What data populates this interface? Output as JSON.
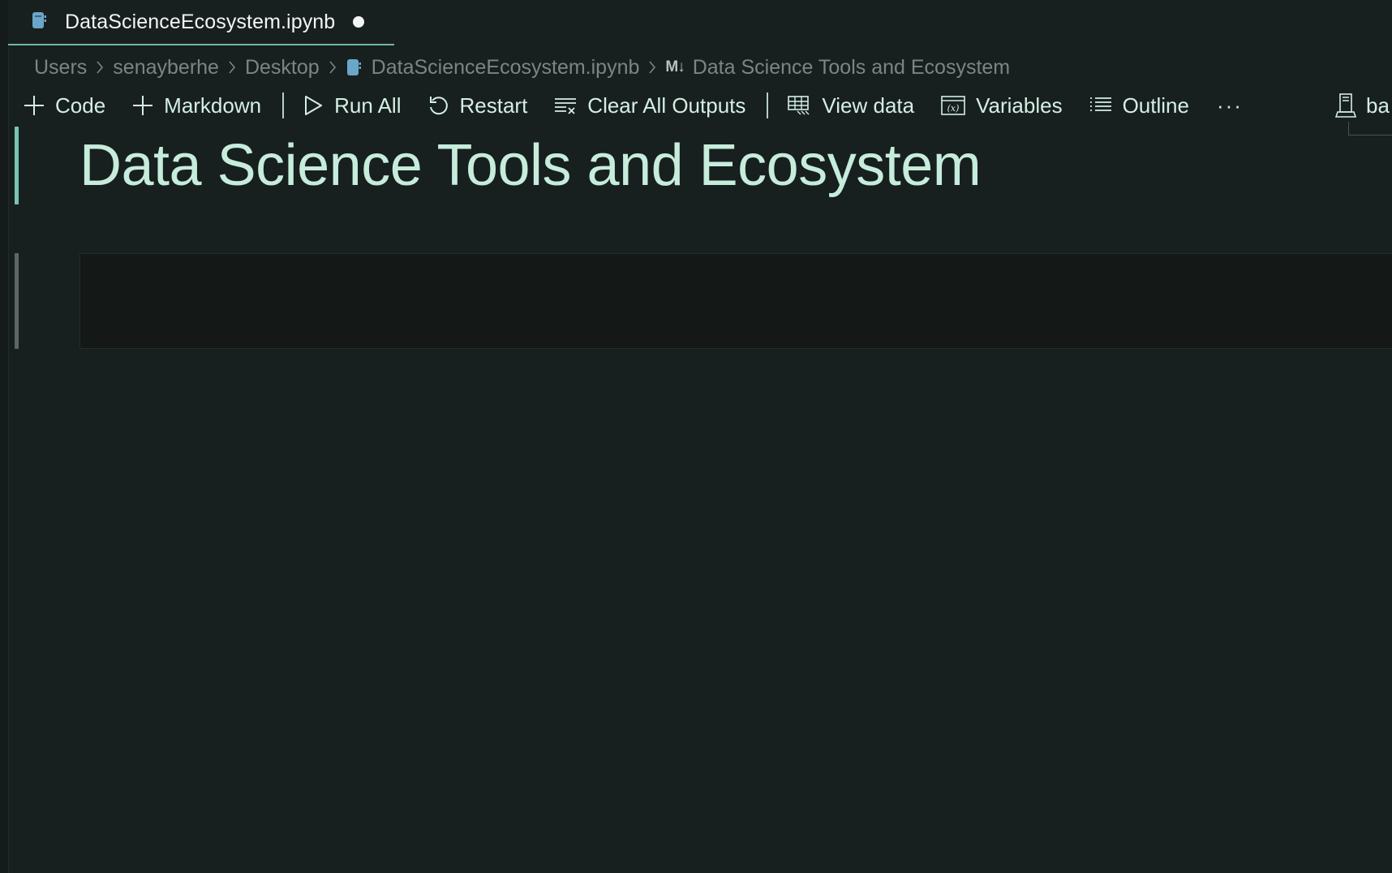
{
  "tab": {
    "title": "DataScienceEcosystem.ipynb",
    "icon": "notebook-icon",
    "unsaved": true
  },
  "breadcrumb": {
    "items": [
      "Users",
      "senayberhe",
      "Desktop",
      "DataScienceEcosystem.ipynb"
    ],
    "markdown_badge": "M↓",
    "current": "Data Science Tools and Ecosystem"
  },
  "toolbar": {
    "code_label": "Code",
    "markdown_label": "Markdown",
    "run_all_label": "Run All",
    "restart_label": "Restart",
    "clear_outputs_label": "Clear All Outputs",
    "view_data_label": "View data",
    "variables_label": "Variables",
    "outline_label": "Outline",
    "more_label": "···",
    "kernel_label": "ba"
  },
  "cells": {
    "heading_text": "Data Science Tools and Ecosystem",
    "code_cell_content": ""
  },
  "colors": {
    "background": "#181f1f",
    "accent": "#79c5b4",
    "heading": "#c6ecdc",
    "toolbar_text": "#d4efe4",
    "breadcrumb_text": "#7c8584",
    "notebook_icon": "#6aa6c9"
  }
}
